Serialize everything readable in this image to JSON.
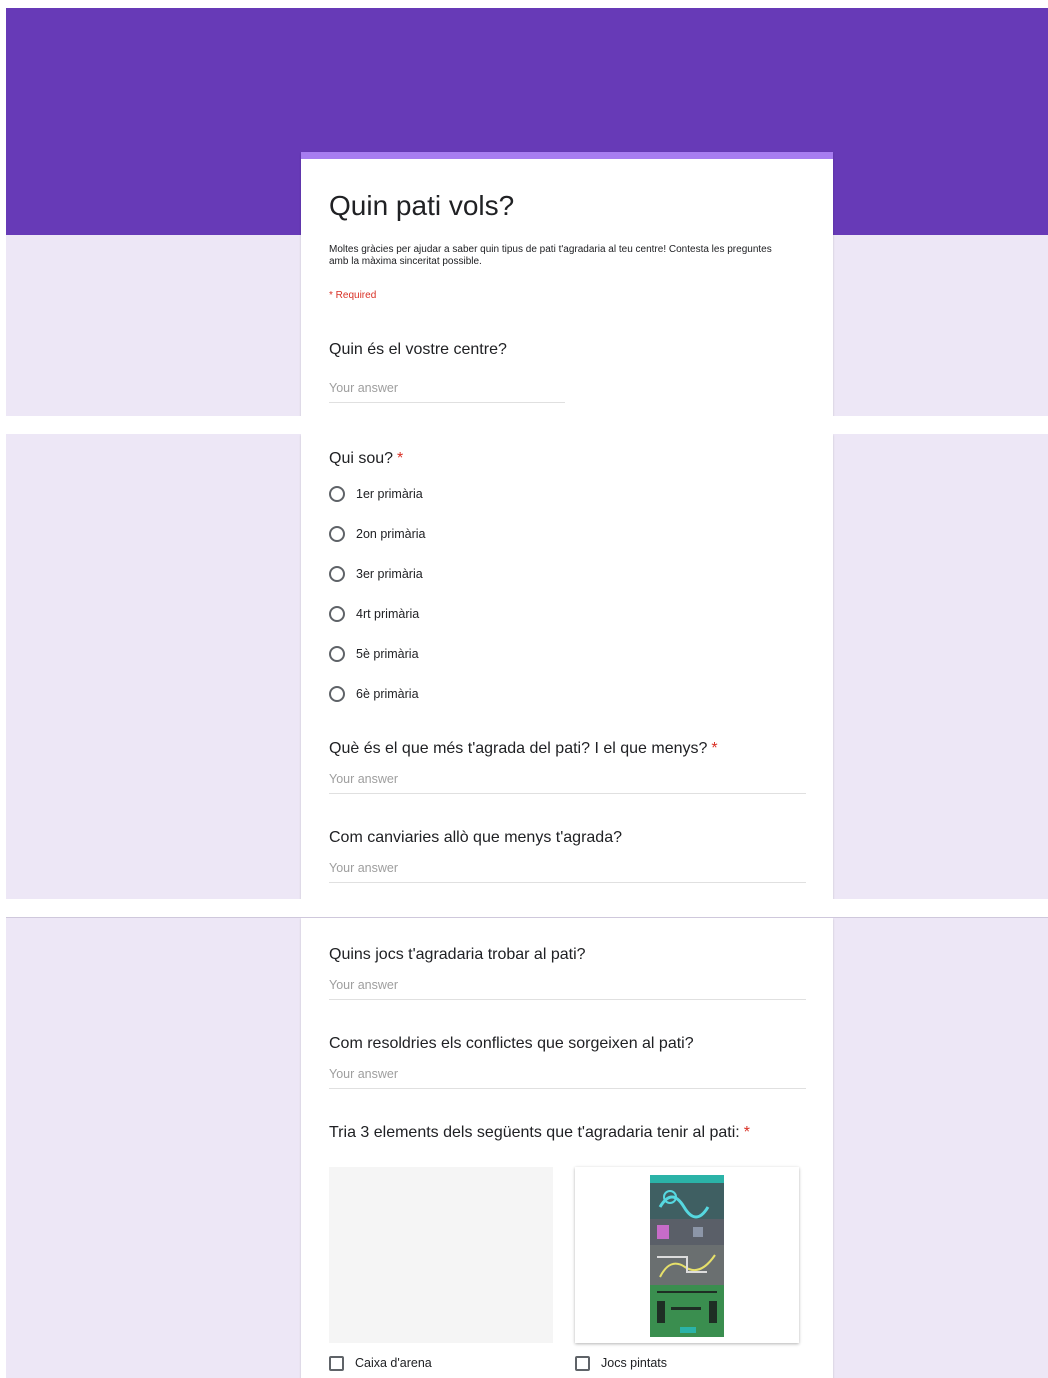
{
  "colors": {
    "banner": "#673ab7",
    "card_accent": "#a77cf0",
    "page_bg": "#ede7f6",
    "required": "#d93025"
  },
  "form": {
    "title": "Quin pati vols?",
    "description": "Moltes gràcies per ajudar a saber quin tipus de pati t'agradaria al teu centre! Contesta les preguntes amb la màxima sinceritat possible.",
    "required_note": "* Required",
    "answer_placeholder": "Your answer"
  },
  "questions": {
    "q1": {
      "title": "Quin és el vostre centre?"
    },
    "q2": {
      "title": "Qui sou?",
      "required_mark": "*",
      "options": [
        "1er primària",
        "2on primària",
        "3er primària",
        "4rt primària",
        "5è primària",
        "6è primària"
      ]
    },
    "q3": {
      "title": "Què és el que més t'agrada del pati? I el que menys?",
      "required_mark": "*"
    },
    "q4": {
      "title": "Com canviaries allò que menys t'agrada?"
    },
    "q5": {
      "title": "Quins jocs t'agradaria trobar al pati?"
    },
    "q6": {
      "title": "Com resoldries els conflictes que sorgeixen al pati?"
    },
    "q7": {
      "title": "Tria 3 elements dels següents que t'agradaria tenir al pati:",
      "required_mark": "*",
      "options": [
        "Caixa d'arena",
        "Jocs pintats"
      ]
    }
  }
}
